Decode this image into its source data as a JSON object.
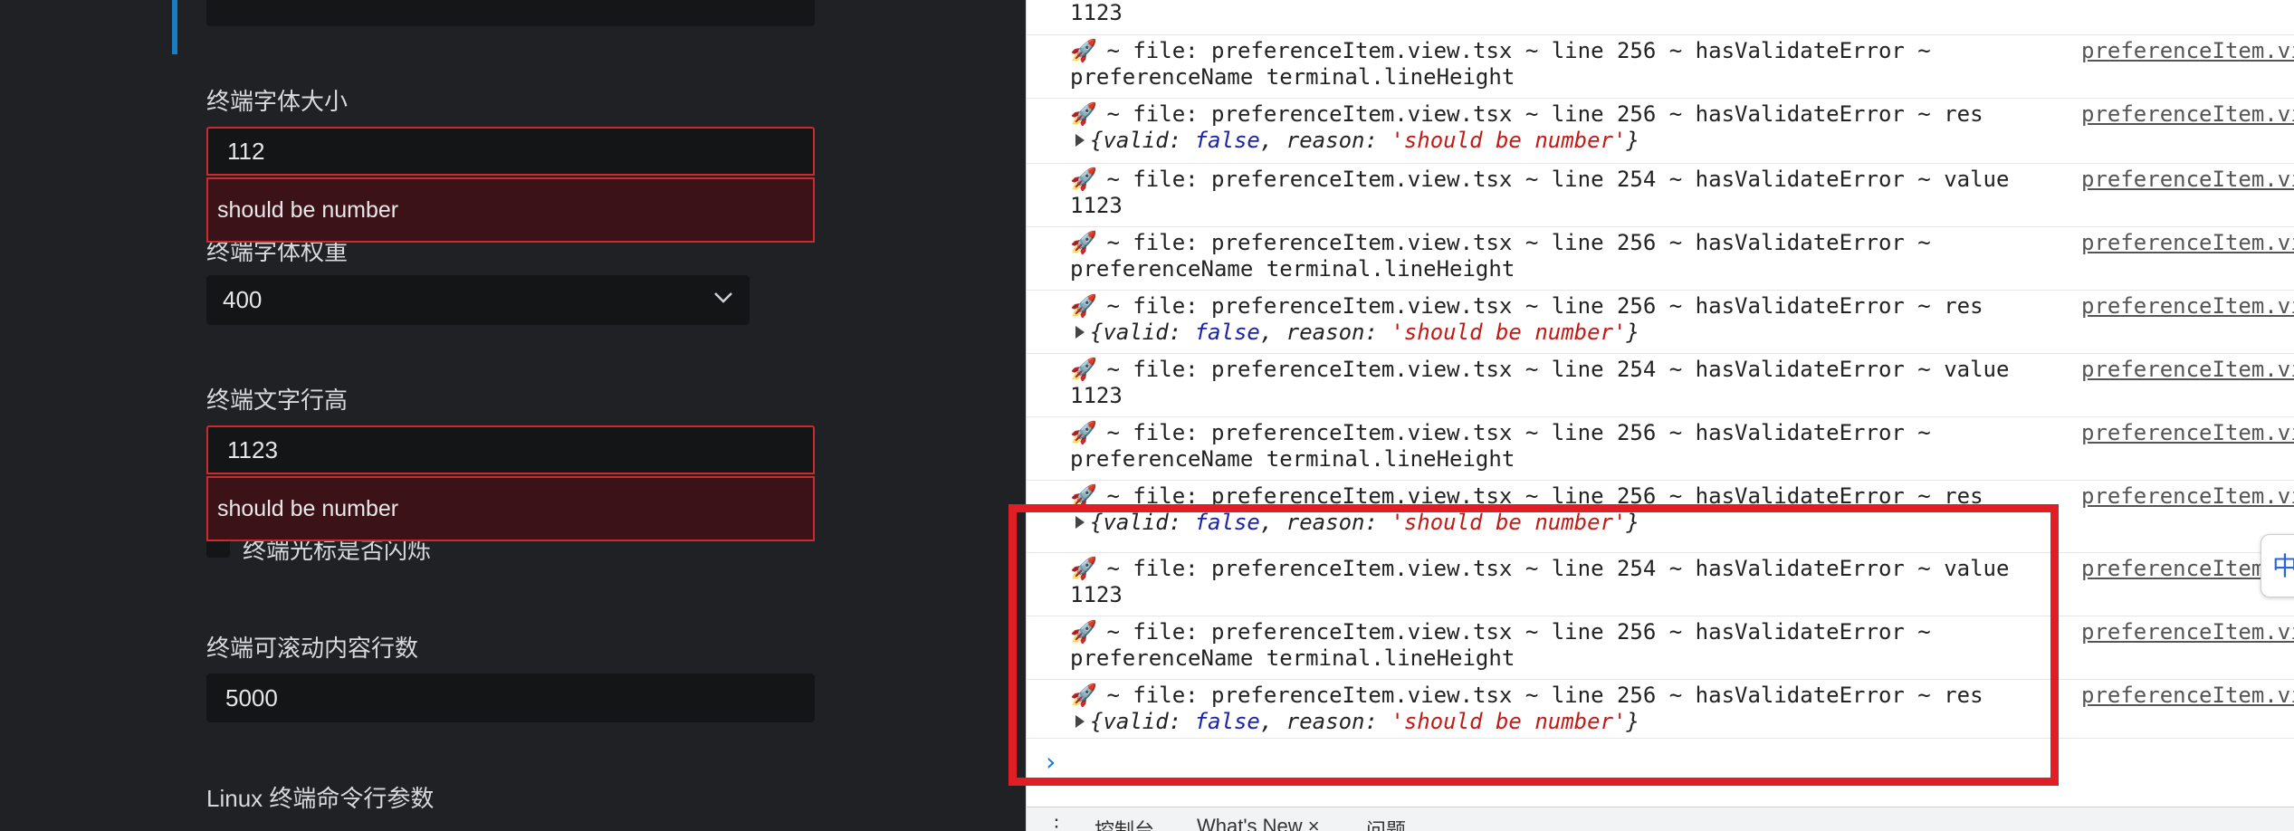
{
  "settings": {
    "font_size_label": "终端字体大小",
    "font_size_value": "112",
    "font_size_error": "should be number",
    "font_weight_label": "终端字体权重",
    "font_weight_value": "400",
    "line_height_label": "终端文字行高",
    "line_height_value": "1123",
    "line_height_error": "should be number",
    "cursor_blink_label": "终端光标是否闪烁",
    "scrollback_label": "终端可滚动内容行数",
    "scrollback_value": "5000",
    "linux_args_label": "Linux 终端命令行参数"
  },
  "console": {
    "top_partial_value": "1123",
    "entries": [
      {
        "line1": " ~ file: preferenceItem.view.tsx ~ line 256 ~ hasValidateError ~",
        "line2": "preferenceName terminal.lineHeight",
        "source": "preferenceItem.vi"
      },
      {
        "line1": " ~ file: preferenceItem.view.tsx ~ line 256 ~ hasValidateError ~ res",
        "obj_valid": "valid",
        "obj_false": "false",
        "obj_reason": "reason",
        "obj_msg": "'should be number'",
        "source": "preferenceItem.vi"
      },
      {
        "line1": " ~ file: preferenceItem.view.tsx ~ line 254 ~ hasValidateError ~ value",
        "line2": "1123",
        "source": "preferenceItem.vi"
      },
      {
        "line1": " ~ file: preferenceItem.view.tsx ~ line 256 ~ hasValidateError ~",
        "line2": "preferenceName terminal.lineHeight",
        "source": "preferenceItem.vi"
      },
      {
        "line1": " ~ file: preferenceItem.view.tsx ~ line 256 ~ hasValidateError ~ res",
        "obj_valid": "valid",
        "obj_false": "false",
        "obj_reason": "reason",
        "obj_msg": "'should be number'",
        "source": "preferenceItem.vi"
      },
      {
        "line1": " ~ file: preferenceItem.view.tsx ~ line 254 ~ hasValidateError ~ value",
        "line2": "1123",
        "source": "preferenceItem.vi"
      },
      {
        "line1": " ~ file: preferenceItem.view.tsx ~ line 256 ~ hasValidateError ~",
        "line2": "preferenceName terminal.lineHeight",
        "source": "preferenceItem.vi"
      },
      {
        "line1": " ~ file: preferenceItem.view.tsx ~ line 256 ~ hasValidateError ~ res",
        "obj_valid": "valid",
        "obj_false": "false",
        "obj_reason": "reason",
        "obj_msg": "'should be number'",
        "source": "preferenceItem.vi"
      },
      {
        "line1": " ~ file: preferenceItem.view.tsx ~ line 254 ~ hasValidateError ~ value",
        "line2": "1123",
        "source": "preferenceItem"
      },
      {
        "line1": " ~ file: preferenceItem.view.tsx ~ line 256 ~ hasValidateError ~",
        "line2": "preferenceName terminal.lineHeight",
        "source": "preferenceItem.vi"
      },
      {
        "line1": " ~ file: preferenceItem.view.tsx ~ line 256 ~ hasValidateError ~ res",
        "obj_valid": "valid",
        "obj_false": "false",
        "obj_reason": "reason",
        "obj_msg": "'should be number'",
        "source": "preferenceItem.vi"
      }
    ],
    "prompt_symbol": "›",
    "drawer_tabs": {
      "console": "控制台",
      "whats_new": "What's New ×",
      "issues": "问题"
    },
    "side_widget_char": "中"
  },
  "colors": {
    "accent": "#1a7dc2",
    "error_border": "#cd2a2e",
    "highlight": "#e11d26"
  }
}
